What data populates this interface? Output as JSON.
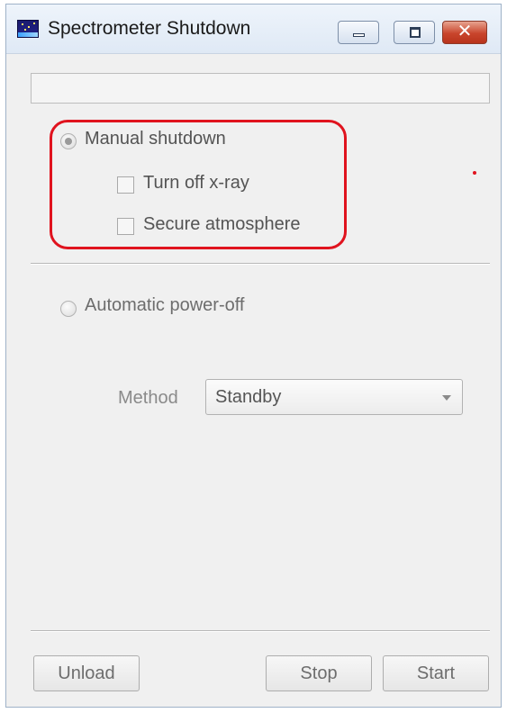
{
  "window": {
    "title": "Spectrometer Shutdown",
    "close_glyph": "✕"
  },
  "icons": {
    "app": "spectrometer-app-icon",
    "minimize": "minimize-icon",
    "maximize": "maximize-icon",
    "close": "close-icon",
    "dropdown": "chevron-down-icon"
  },
  "status": {
    "value": ""
  },
  "manual": {
    "label": "Manual shutdown",
    "selected": true,
    "options": [
      {
        "label": "Turn off x-ray",
        "checked": false
      },
      {
        "label": "Secure atmosphere",
        "checked": false
      }
    ]
  },
  "automatic": {
    "label": "Automatic power-off",
    "selected": false,
    "method_label": "Method",
    "method_value": "Standby"
  },
  "buttons": {
    "unload": "Unload",
    "stop": "Stop",
    "start": "Start"
  },
  "colors": {
    "highlight": "#e0131e",
    "close_button": "#c9452c",
    "window_bg": "#f0f0f0"
  }
}
